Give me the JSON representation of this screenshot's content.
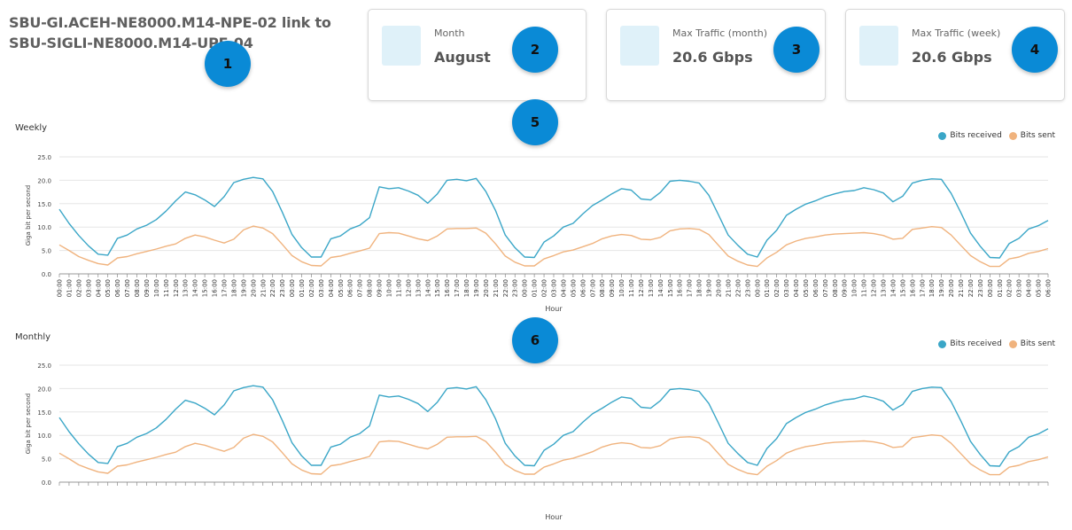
{
  "header": {
    "title": "SBU-GI.ACEH-NE8000.M14-NPE-02 link to SBU-SIGLI-NE8000.M14-UPE-04"
  },
  "cards": [
    {
      "label": "Month",
      "value": "August"
    },
    {
      "label": "Max Traffic (month)",
      "value": "20.6 Gbps"
    },
    {
      "label": "Max Traffic (week)",
      "value": "20.6 Gbps"
    }
  ],
  "badges": [
    "1",
    "2",
    "3",
    "4",
    "5",
    "6"
  ],
  "colors": {
    "received": "#3aa6c7",
    "sent": "#f0b37e",
    "badge": "#0a8ad6"
  },
  "legend": {
    "received": "Bits received",
    "sent": "Bits sent"
  },
  "chart_data": [
    {
      "type": "line",
      "title": "Weekly",
      "xlabel": "Hour",
      "ylabel": "Giga bit per second",
      "ylim": [
        0,
        25
      ],
      "yticks": [
        "0.0",
        "5.0",
        "10.0",
        "15.0",
        "20.0",
        "25.0"
      ],
      "x": [
        "00:00",
        "01:00",
        "02:00",
        "03:00",
        "04:00",
        "05:00",
        "06:00",
        "07:00",
        "08:00",
        "09:00",
        "10:00",
        "11:00",
        "12:00",
        "13:00",
        "14:00",
        "15:00",
        "16:00",
        "17:00",
        "18:00",
        "19:00",
        "20:00",
        "21:00",
        "22:00",
        "23:00",
        "00:00",
        "01:00",
        "02:00",
        "03:00",
        "04:00",
        "05:00",
        "06:00",
        "07:00",
        "08:00",
        "09:00",
        "10:00",
        "11:00",
        "12:00",
        "13:00",
        "14:00",
        "15:00",
        "16:00",
        "17:00",
        "18:00",
        "19:00",
        "20:00",
        "21:00",
        "22:00",
        "23:00",
        "00:00",
        "01:00",
        "02:00",
        "03:00",
        "04:00",
        "05:00",
        "06:00",
        "07:00",
        "08:00",
        "09:00",
        "10:00",
        "11:00",
        "12:00",
        "13:00",
        "14:00",
        "15:00",
        "16:00",
        "17:00",
        "18:00",
        "19:00",
        "20:00",
        "21:00",
        "22:00",
        "23:00",
        "00:00",
        "01:00",
        "02:00",
        "03:00",
        "04:00",
        "05:00",
        "06:00",
        "07:00",
        "08:00",
        "09:00",
        "10:00",
        "11:00",
        "12:00",
        "13:00",
        "14:00",
        "15:00",
        "16:00",
        "17:00",
        "18:00",
        "19:00",
        "20:00",
        "21:00",
        "22:00",
        "23:00",
        "00:00",
        "01:00",
        "02:00",
        "03:00",
        "04:00",
        "05:00",
        "06:00",
        "07:00",
        "08:00",
        "09:00",
        "10:00"
      ],
      "series": [
        {
          "name": "Bits received",
          "values": [
            13.8,
            10.8,
            8.2,
            6.0,
            4.2,
            4.0,
            7.6,
            8.3,
            9.6,
            10.4,
            11.6,
            13.4,
            15.6,
            17.5,
            16.9,
            15.8,
            14.4,
            16.5,
            19.5,
            20.2,
            20.6,
            20.3,
            17.6,
            13.2,
            8.4,
            5.6,
            3.6,
            3.6,
            7.5,
            8.1,
            9.6,
            10.4,
            12.0,
            18.6,
            18.2,
            18.4,
            17.7,
            16.8,
            15.1,
            17.1,
            20.0,
            20.2,
            19.9,
            20.4,
            17.6,
            13.5,
            8.3,
            5.6,
            3.6,
            3.5,
            6.8,
            8.1,
            10.0,
            10.8,
            12.8,
            14.6,
            15.8,
            17.1,
            18.2,
            17.9,
            16.0,
            15.8,
            17.4,
            19.8,
            20.0,
            19.8,
            19.4,
            16.8,
            12.6,
            8.3,
            6.1,
            4.2,
            3.6,
            7.2,
            9.3,
            12.5,
            13.8,
            14.9,
            15.6,
            16.5,
            17.1,
            17.6,
            17.8,
            18.4,
            18.0,
            17.3,
            15.4,
            16.6,
            19.4,
            20.0,
            20.3,
            20.2,
            17.2,
            13.1,
            8.7,
            5.9,
            3.5,
            3.4,
            6.5,
            7.6,
            9.6,
            10.3,
            11.4
          ]
        },
        {
          "name": "Bits sent",
          "values": [
            6.2,
            5.0,
            3.7,
            2.9,
            2.2,
            1.9,
            3.4,
            3.7,
            4.3,
            4.8,
            5.3,
            5.9,
            6.4,
            7.6,
            8.3,
            7.9,
            7.2,
            6.6,
            7.4,
            9.4,
            10.2,
            9.8,
            8.6,
            6.3,
            3.9,
            2.6,
            1.8,
            1.7,
            3.5,
            3.8,
            4.4,
            4.9,
            5.5,
            8.6,
            8.8,
            8.7,
            8.1,
            7.5,
            7.1,
            8.1,
            9.6,
            9.7,
            9.7,
            9.8,
            8.7,
            6.4,
            3.8,
            2.5,
            1.7,
            1.7,
            3.2,
            3.9,
            4.7,
            5.1,
            5.8,
            6.5,
            7.5,
            8.1,
            8.4,
            8.2,
            7.4,
            7.3,
            7.8,
            9.2,
            9.6,
            9.7,
            9.5,
            8.4,
            6.1,
            3.8,
            2.7,
            1.9,
            1.6,
            3.4,
            4.6,
            6.2,
            7.0,
            7.6,
            7.9,
            8.3,
            8.5,
            8.6,
            8.7,
            8.8,
            8.6,
            8.2,
            7.4,
            7.6,
            9.5,
            9.8,
            10.1,
            9.9,
            8.3,
            6.1,
            3.9,
            2.6,
            1.6,
            1.6,
            3.2,
            3.6,
            4.4,
            4.8,
            5.4
          ]
        }
      ]
    },
    {
      "type": "line",
      "title": "Monthly",
      "xlabel": "Hour",
      "ylabel": "Giga bit per second",
      "ylim": [
        0,
        25
      ],
      "yticks": [
        "0.0",
        "5.0",
        "10.0",
        "15.0",
        "20.0",
        "25.0"
      ],
      "series": [
        {
          "name": "Bits received",
          "values": [
            13.8,
            10.8,
            8.2,
            6.0,
            4.2,
            4.0,
            7.6,
            8.3,
            9.6,
            10.4,
            11.6,
            13.4,
            15.6,
            17.5,
            16.9,
            15.8,
            14.4,
            16.5,
            19.5,
            20.2,
            20.6,
            20.3,
            17.6,
            13.2,
            8.4,
            5.6,
            3.6,
            3.6,
            7.5,
            8.1,
            9.6,
            10.4,
            12.0,
            18.6,
            18.2,
            18.4,
            17.7,
            16.8,
            15.1,
            17.1,
            20.0,
            20.2,
            19.9,
            20.4,
            17.6,
            13.5,
            8.3,
            5.6,
            3.6,
            3.5,
            6.8,
            8.1,
            10.0,
            10.8,
            12.8,
            14.6,
            15.8,
            17.1,
            18.2,
            17.9,
            16.0,
            15.8,
            17.4,
            19.8,
            20.0,
            19.8,
            19.4,
            16.8,
            12.6,
            8.3,
            6.1,
            4.2,
            3.6,
            7.2,
            9.3,
            12.5,
            13.8,
            14.9,
            15.6,
            16.5,
            17.1,
            17.6,
            17.8,
            18.4,
            18.0,
            17.3,
            15.4,
            16.6,
            19.4,
            20.0,
            20.3,
            20.2,
            17.2,
            13.1,
            8.7,
            5.9,
            3.5,
            3.4,
            6.5,
            7.6,
            9.6,
            10.3,
            11.4
          ]
        },
        {
          "name": "Bits sent",
          "values": [
            6.2,
            5.0,
            3.7,
            2.9,
            2.2,
            1.9,
            3.4,
            3.7,
            4.3,
            4.8,
            5.3,
            5.9,
            6.4,
            7.6,
            8.3,
            7.9,
            7.2,
            6.6,
            7.4,
            9.4,
            10.2,
            9.8,
            8.6,
            6.3,
            3.9,
            2.6,
            1.8,
            1.7,
            3.5,
            3.8,
            4.4,
            4.9,
            5.5,
            8.6,
            8.8,
            8.7,
            8.1,
            7.5,
            7.1,
            8.1,
            9.6,
            9.7,
            9.7,
            9.8,
            8.7,
            6.4,
            3.8,
            2.5,
            1.7,
            1.7,
            3.2,
            3.9,
            4.7,
            5.1,
            5.8,
            6.5,
            7.5,
            8.1,
            8.4,
            8.2,
            7.4,
            7.3,
            7.8,
            9.2,
            9.6,
            9.7,
            9.5,
            8.4,
            6.1,
            3.8,
            2.7,
            1.9,
            1.6,
            3.4,
            4.6,
            6.2,
            7.0,
            7.6,
            7.9,
            8.3,
            8.5,
            8.6,
            8.7,
            8.8,
            8.6,
            8.2,
            7.4,
            7.6,
            9.5,
            9.8,
            10.1,
            9.9,
            8.3,
            6.1,
            3.9,
            2.6,
            1.6,
            1.6,
            3.2,
            3.6,
            4.4,
            4.8,
            5.4
          ]
        }
      ]
    }
  ]
}
